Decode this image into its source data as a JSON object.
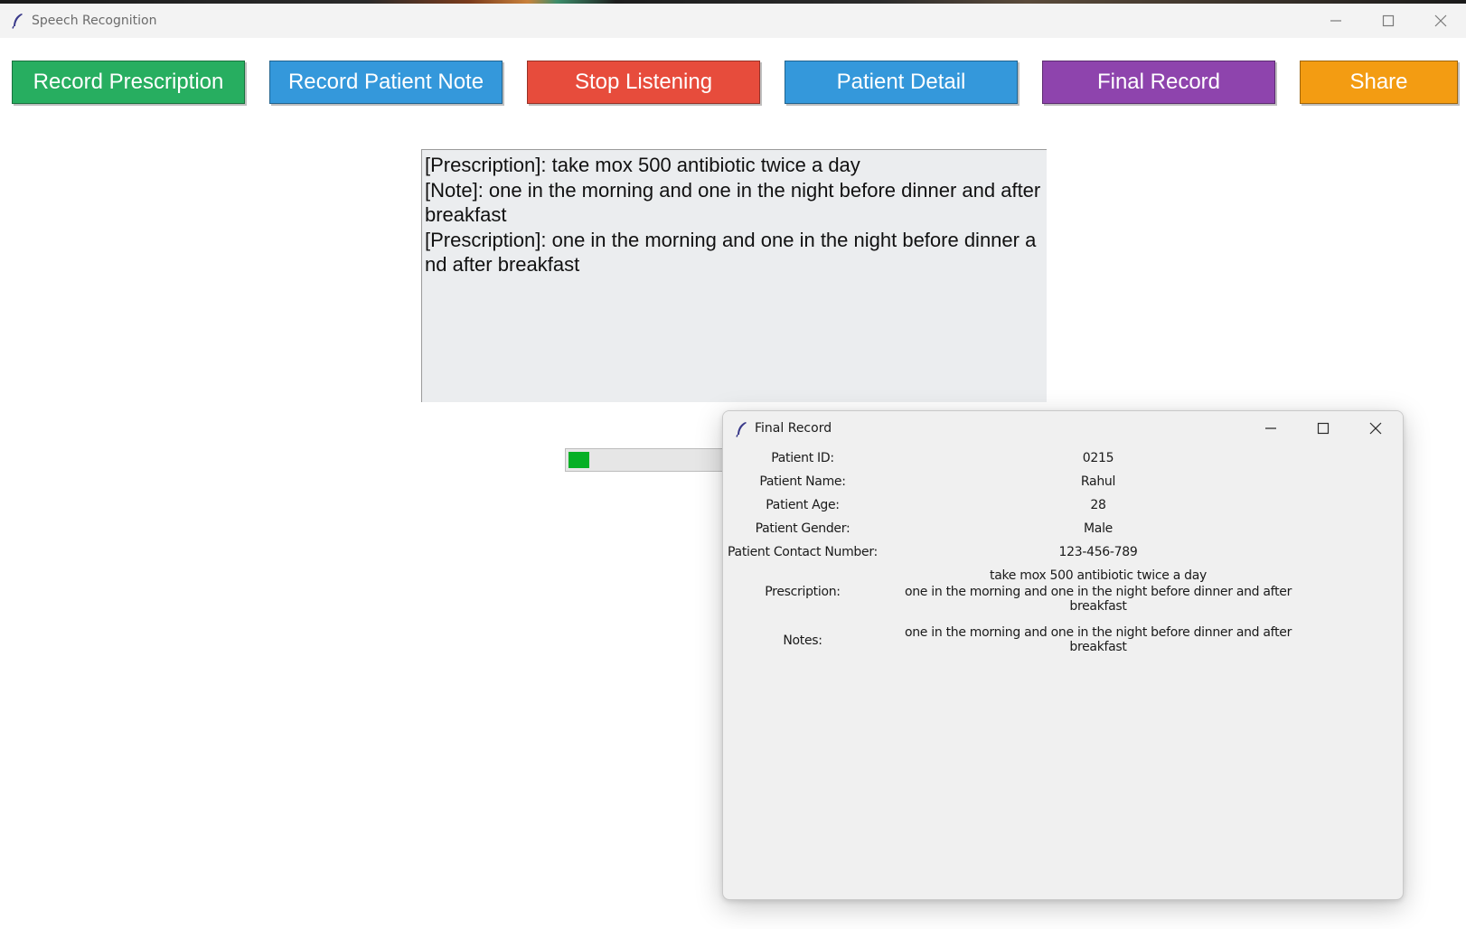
{
  "main_window": {
    "title": "Speech Recognition",
    "controls": {
      "minimize": "minimize-icon",
      "maximize": "maximize-icon",
      "close": "close-icon"
    }
  },
  "toolbar": {
    "buttons": [
      {
        "label": "Record Prescription",
        "color": "#27ae60"
      },
      {
        "label": "Record Patient Note",
        "color": "#3498db"
      },
      {
        "label": "Stop Listening",
        "color": "#e74c3c"
      },
      {
        "label": "Patient Detail",
        "color": "#3498db"
      },
      {
        "label": "Final Record",
        "color": "#8e44ad"
      },
      {
        "label": "Share",
        "color": "#f39c12"
      }
    ]
  },
  "transcript": {
    "lines": [
      "[Prescription]: take mox 500 antibiotic twice a day",
      "[Note]: one in the morning and one in the night before dinner and after breakfast",
      "[Prescription]: one in the morning and one in the night before dinner and after breakfast"
    ]
  },
  "progress": {
    "fraction": 0.12,
    "color": "#06b025"
  },
  "final_record_dialog": {
    "title": "Final Record",
    "fields": {
      "patient_id": {
        "label": "Patient ID:",
        "value": "0215"
      },
      "patient_name": {
        "label": "Patient Name:",
        "value": "Rahul"
      },
      "patient_age": {
        "label": "Patient Age:",
        "value": "28"
      },
      "patient_gender": {
        "label": "Patient Gender:",
        "value": "Male"
      },
      "patient_contact": {
        "label": "Patient Contact Number:",
        "value": "123-456-789"
      }
    },
    "prescription": {
      "label": "Prescription:",
      "lines": [
        "take mox 500 antibiotic twice a day",
        "one in the morning and one in the night before dinner and after breakfast"
      ]
    },
    "notes": {
      "label": "Notes:",
      "lines": [
        "one in the morning and one in the night before dinner and after breakfast"
      ]
    }
  }
}
